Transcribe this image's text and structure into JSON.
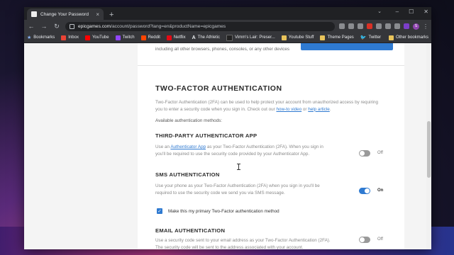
{
  "browser": {
    "tab_title": "Change Your Password",
    "tab_close": "×",
    "new_tab": "+",
    "url_host": "epicgames.com",
    "url_path": "/account/password?lang=en&productName=epicgames",
    "window_controls": [
      "–",
      "☐",
      "✕"
    ]
  },
  "bookmarks": [
    {
      "label": "Bookmarks",
      "icon": "star-icon"
    },
    {
      "label": "Inbox",
      "icon": "gmail-icon"
    },
    {
      "label": "YouTube",
      "icon": "youtube-icon"
    },
    {
      "label": "Twitch",
      "icon": "twitch-icon"
    },
    {
      "label": "Reddit",
      "icon": "reddit-icon"
    },
    {
      "label": "Netflix",
      "icon": "netflix-icon"
    },
    {
      "label": "The Athletic",
      "icon": "athletic-icon"
    },
    {
      "label": "Vimm's Lair: Preser...",
      "icon": "vimm-icon"
    },
    {
      "label": "Youtube Stuff",
      "icon": "folder-icon"
    },
    {
      "label": "Theme Pages",
      "icon": "folder-icon"
    },
    {
      "label": "Twitter",
      "icon": "twitter-icon"
    }
  ],
  "other_bookmarks": "Other bookmarks",
  "page": {
    "prev_text": "including all other browsers, phones, consoles, or any other devices",
    "title": "TWO-FACTOR AUTHENTICATION",
    "intro_pre": "Two-Factor Authentication (2FA) can be used to help protect your account from unauthorized access by requiring you to enter a security code when you sign in. Check out our ",
    "intro_link1": "how-to video",
    "intro_mid": " or ",
    "intro_link2": "help article",
    "intro_post": ".",
    "available_methods": "Available authentication methods:",
    "sections": [
      {
        "title": "THIRD-PARTY AUTHENTICATOR APP",
        "desc_pre": "Use an ",
        "desc_link": "Authenticator App",
        "desc_post": " as your Two-Factor Authentication (2FA). When you sign in you'll be required to use the security code provided by your Authenticator App.",
        "toggle_label": "Off",
        "enabled": false
      },
      {
        "title": "SMS AUTHENTICATION",
        "desc": "Use your phone as your Two-Factor Authentication (2FA) when you sign in you'll be required to use the security code we send you via SMS message.",
        "toggle_label": "On",
        "enabled": true,
        "primary_checkbox_label": "Make this my primary Two-Factor authentication method"
      },
      {
        "title": "EMAIL AUTHENTICATION",
        "desc": "Use a security code sent to your email address as your Two-Factor Authentication (2FA). The security code will be sent to the address associated with your account.",
        "toggle_label": "Off",
        "enabled": false
      }
    ]
  },
  "colors": {
    "accent": "#2f7ad1",
    "browser_dark": "#35363a"
  }
}
